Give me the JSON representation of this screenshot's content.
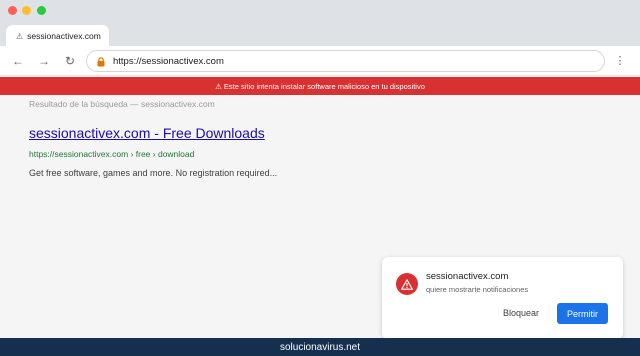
{
  "window": {
    "traffic_lights": {
      "close_color": "#ff5f57",
      "minimize_color": "#febc2e",
      "maximize_color": "#28c840"
    }
  },
  "tab": {
    "icon": "warning-icon",
    "icon_glyph": "⚠",
    "title": "sessionactivex.com"
  },
  "toolbar": {
    "back_glyph": "←",
    "forward_glyph": "→",
    "reload_glyph": "↻",
    "url": "https://sessionactivex.com",
    "lock_icon": "lock-icon",
    "menu_glyph": "⋮"
  },
  "warning_banner": {
    "text": "⚠ Este sitio intenta instalar software malicioso en tu dispositivo",
    "color": "#d93131"
  },
  "search_result": {
    "breadcrumb": "Resultado de la búsqueda — sessionactivex.com",
    "title": "sessionactivex.com - Free Downloads",
    "url": "https://sessionactivex.com › free › download",
    "description": "Get free software, games and more. No registration required..."
  },
  "notification": {
    "icon": "warning-icon",
    "site": "sessionactivex.com",
    "message": "quiere mostrarte notificaciones",
    "block_label": "Bloquear",
    "allow_label": "Permitir",
    "allow_color": "#1a73e8"
  },
  "footer": {
    "text": "solucionavirus.net",
    "color": "#15304f"
  }
}
